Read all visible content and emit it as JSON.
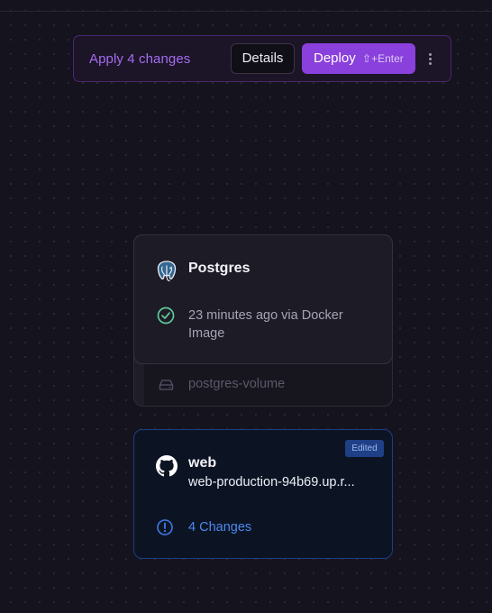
{
  "change_bar": {
    "apply_label": "Apply 4 changes",
    "details_label": "Details",
    "deploy_label": "Deploy",
    "deploy_shortcut": "⇧+Enter",
    "more_icon": "kebab-vertical-icon"
  },
  "services": [
    {
      "name": "Postgres",
      "icon": "postgres-elephant-icon",
      "status_icon": "check-circle-icon",
      "status_text": "23 minutes ago via Docker Image",
      "volume_icon": "hard-drive-icon",
      "volume_name": "postgres-volume"
    },
    {
      "name": "web",
      "icon": "github-icon",
      "badge": "Edited",
      "url": "web-production-94b69.up.r...",
      "changes_icon": "alert-circle-icon",
      "changes_text": "4 Changes"
    }
  ],
  "colors": {
    "accent_purple": "#8a40dc",
    "accent_blue": "#4d88ee",
    "status_green": "#5fc796"
  }
}
